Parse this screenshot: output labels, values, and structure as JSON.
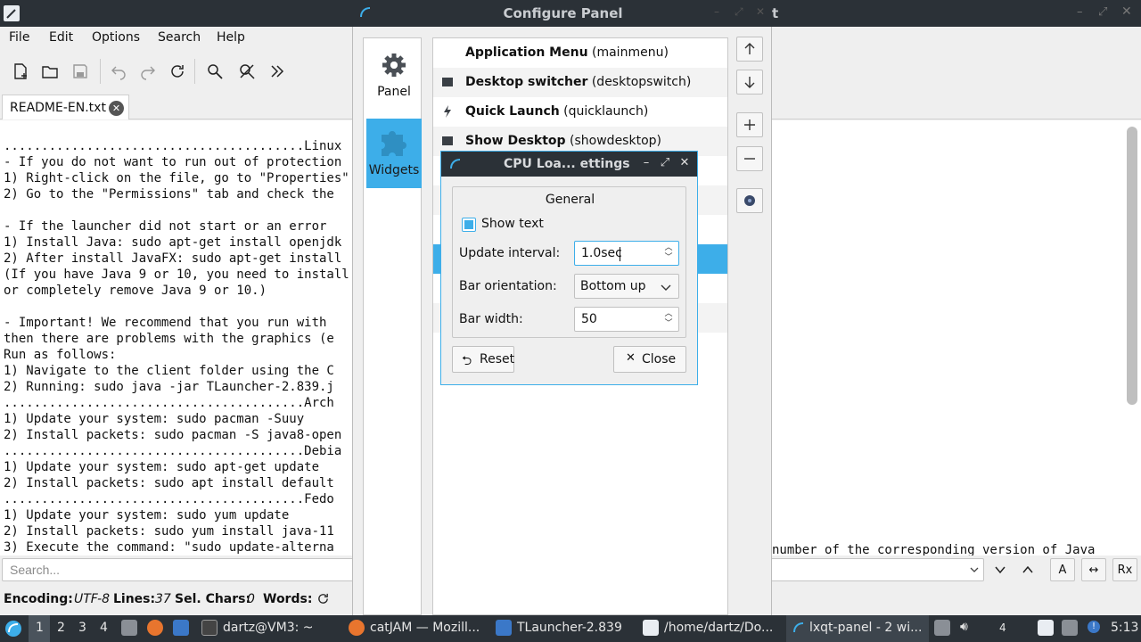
{
  "editor": {
    "title_partial": "t",
    "menu": [
      "File",
      "Edit",
      "Options",
      "Search",
      "Help"
    ],
    "tab_label": "README-EN.txt",
    "text_lines": [
      "........................................Linux",
      "- If you do not want to run out of protection",
      "1) Right-click on the file, go to \"Properties\"",
      "2) Go to the \"Permissions\" tab and check the",
      "",
      "- If the launcher did not start or an error",
      "1) Install Java: sudo apt-get install openjdk",
      "2) After install JavaFX: sudo apt-get install",
      "(If you have Java 9 or 10, you need to install",
      "or completely remove Java 9 or 10.)",
      "",
      "- Important! We recommend that you run with",
      "then there are problems with the graphics (e",
      "Run as follows:",
      "1) Navigate to the client folder using the C",
      "2) Running: sudo java -jar TLauncher-2.839.j",
      "........................................Arch",
      "1) Update your system: sudo pacman -Suuy",
      "2) Install packets: sudo pacman -S java8-open",
      "........................................Debia",
      "1) Update your system: sudo apt-get update",
      "2) Install packets: sudo apt install default",
      "........................................Fedo",
      "1) Update your system: sudo yum update",
      "2) Install packets: sudo yum install java-11",
      "3) Execute the command: \"sudo update-alterna"
    ],
    "text_right_line": "number of the corresponding version of Java",
    "search_placeholder": "Search...",
    "status": {
      "encoding_label": "Encoding:",
      "encoding_value": "UTF-8",
      "lines_label": "Lines:",
      "lines_value": "37",
      "sel_label": "Sel. Chars:",
      "sel_value": "0",
      "words_label": "Words:"
    },
    "search_buttons": {
      "match_case": "A",
      "whole_word": "↔",
      "regex": "Rx"
    }
  },
  "configure_panel": {
    "title": "Configure Panel",
    "sidebar": [
      {
        "label": "Panel",
        "icon": "gear-icon"
      },
      {
        "label": "Widgets",
        "icon": "puzzle-icon"
      }
    ],
    "widgets": [
      {
        "name": "Application Menu",
        "id": "(mainmenu)"
      },
      {
        "name": "Desktop switcher",
        "id": "(desktopswitch)"
      },
      {
        "name": "Quick Launch",
        "id": "(quicklaunch)"
      },
      {
        "name": "Show Desktop",
        "id": "(showdesktop)"
      }
    ]
  },
  "cpu_dialog": {
    "title": "CPU Loa... ettings",
    "group_title": "General",
    "show_text_label": "Show text",
    "update_interval_label": "Update interval:",
    "update_interval_value": "1.0sec",
    "bar_orientation_label": "Bar orientation:",
    "bar_orientation_value": "Bottom up",
    "bar_width_label": "Bar width:",
    "bar_width_value": "50",
    "reset_label": "Reset",
    "close_label": "Close"
  },
  "taskbar": {
    "desktops": [
      "1",
      "2",
      "3",
      "4"
    ],
    "tasks": [
      "dartz@VM3: ~",
      "catJAM — Mozill...",
      "TLauncher-2.839",
      "/home/dartz/Do...",
      "lxqt-panel - 2 wi..."
    ],
    "volume_badge": "4",
    "clock": "5:13"
  },
  "colors": {
    "accent": "#3daee9",
    "titlebar": "#2b3137"
  }
}
